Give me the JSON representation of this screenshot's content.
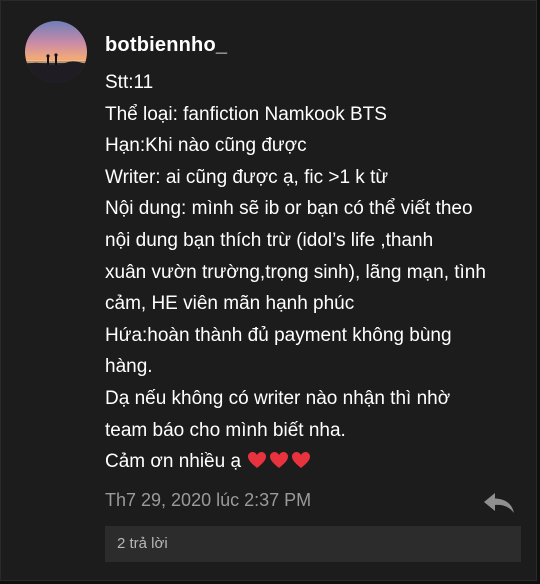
{
  "post": {
    "author": "botbiennho_",
    "lines": [
      "Stt:11",
      "Thể loại: fanfiction Namkook BTS",
      "Hạn:Khi nào cũng được",
      "Writer: ai cũng được ạ, fic >1 k từ",
      "Nội dung: mình sẽ ib or bạn có thể viết theo",
      "nội dung bạn thích trừ  (idol’s life ,thanh",
      "xuân vườn trường,trọng sinh), lãng mạn, tình",
      "cảm, HE viên mãn hạnh phúc",
      "Hứa:hoàn thành đủ payment không  bùng",
      "hàng.",
      "Dạ nếu không có writer nào nhận thì nhờ",
      "team báo cho mình biết nha.",
      "Cảm ơn nhiều ạ"
    ],
    "timestamp": "Th7 29, 2020 lúc 2:37 PM",
    "replies_label": "2 trả lời"
  },
  "icons": {
    "avatar": "sunset-landscape-avatar",
    "hearts": "red-heart-icon",
    "reply": "reply-arrow-icon"
  },
  "colors": {
    "background": "#1c1c1c",
    "text": "#ffffff",
    "meta": "#9a9a9a",
    "heart": "#e8333f",
    "replies_bar": "#2c2c2c"
  }
}
